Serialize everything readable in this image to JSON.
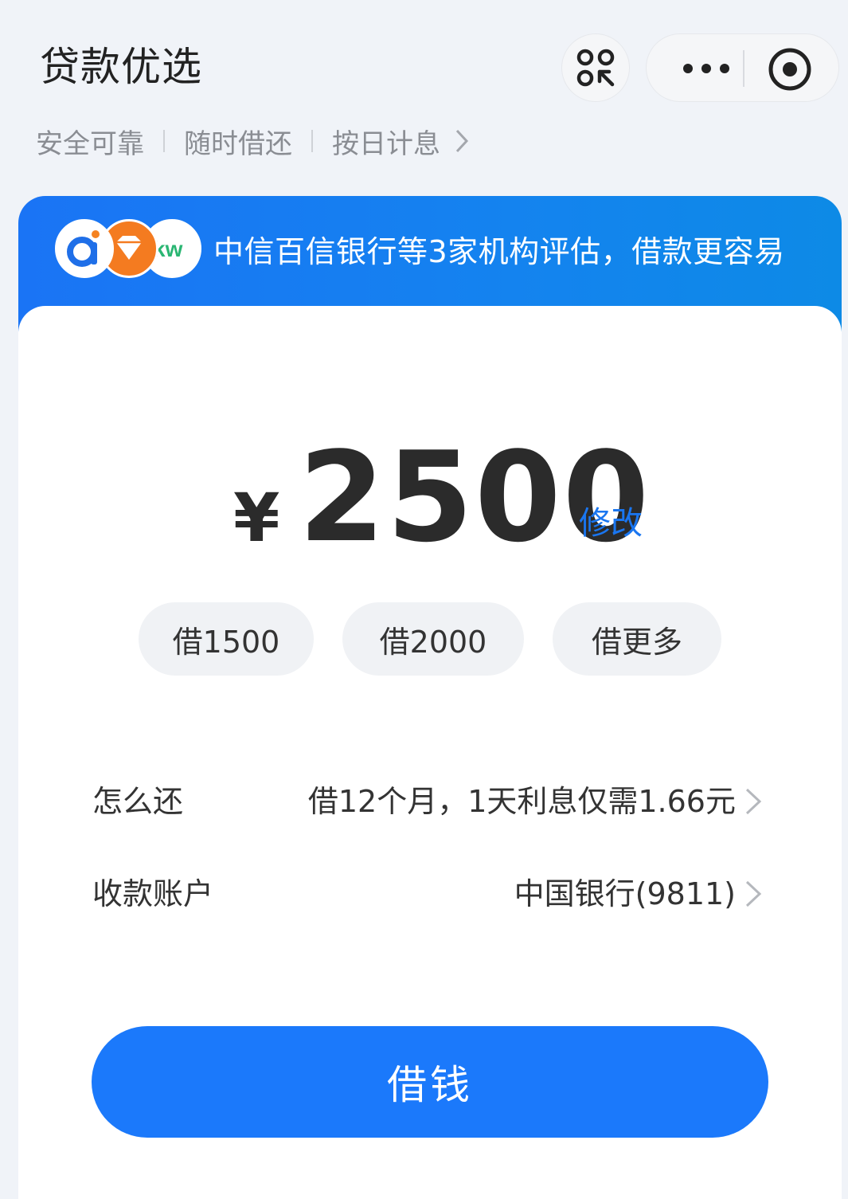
{
  "header": {
    "title": "贷款优选",
    "scan_icon": "scan-code-icon",
    "more_icon": "more-dots-icon",
    "close_icon": "record-target-icon"
  },
  "taglines": [
    "安全可靠",
    "随时借还",
    "按日计息"
  ],
  "banner": {
    "text": "中信百信银行等3家机构评估，借款更容易",
    "logos": [
      "ai-logo",
      "diamond-logo",
      "kw-logo"
    ]
  },
  "loan": {
    "currency": "¥",
    "amount": "2500",
    "edit_label": "修改"
  },
  "quick_amounts": [
    "借1500",
    "借2000",
    "借更多"
  ],
  "repayment": {
    "label": "怎么还",
    "value": "借12个月，1天利息仅需1.66元"
  },
  "account": {
    "label": "收款账户",
    "value": "中国银行(9811)"
  },
  "cta": {
    "label": "借钱"
  },
  "colors": {
    "accent": "#1b79fb",
    "banner": "#1a74f5",
    "background": "#f0f3f8"
  }
}
